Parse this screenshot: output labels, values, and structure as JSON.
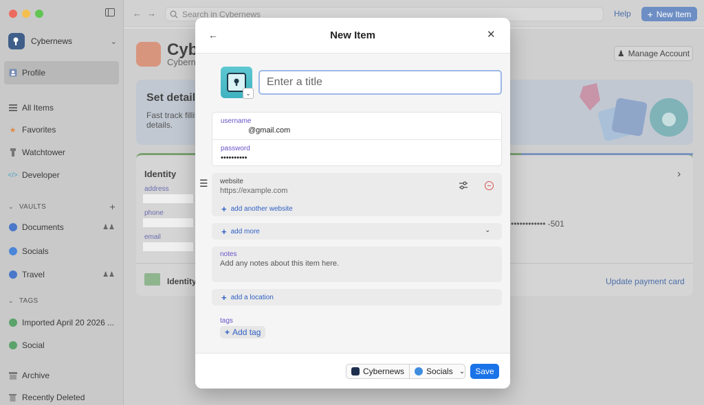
{
  "topbar": {
    "search_placeholder": "Search in Cybernews",
    "help_label": "Help",
    "new_item_label": "New Item"
  },
  "sidebar": {
    "account_name": "Cybernews",
    "profile_label": "Profile",
    "items": [
      {
        "label": "All Items",
        "icon": "all-items-icon"
      },
      {
        "label": "Favorites",
        "icon": "star-icon"
      },
      {
        "label": "Watchtower",
        "icon": "watchtower-icon"
      },
      {
        "label": "Developer",
        "icon": "code-icon"
      }
    ],
    "vaults_heading": "VAULTS",
    "vaults": [
      {
        "label": "Documents",
        "color": "#4a78c9"
      },
      {
        "label": "Socials",
        "color": "#4a86d9"
      },
      {
        "label": "Travel",
        "color": "#4a78c9"
      }
    ],
    "tags_heading": "TAGS",
    "tags": [
      {
        "label": "Imported April 20 2026 ...",
        "color": "#5aa36b"
      },
      {
        "label": "Social",
        "color": "#5aa36b"
      }
    ],
    "archive_label": "Archive",
    "deleted_label": "Recently Deleted"
  },
  "main": {
    "title": "Cyb",
    "subtitle": "Cybern",
    "manage_account_label": "Manage Account",
    "banner_title": "Set details",
    "banner_text": "Fast track fillin details.",
    "card": {
      "title": "Identity",
      "labels": [
        "address",
        "phone",
        "email"
      ],
      "masked_number": "•••••••••••• -501",
      "footer_item": "Identity",
      "update_link": "Update payment card"
    }
  },
  "modal": {
    "title": "New Item",
    "title_placeholder": "Enter a title",
    "username_label": "username",
    "username_value": "@gmail.com",
    "password_label": "password",
    "password_value": "••••••••••",
    "website_label": "website",
    "website_placeholder": "https://example.com",
    "add_website_label": "add another website",
    "add_more_label": "add more",
    "notes_label": "notes",
    "notes_placeholder": "Add any notes about this item here.",
    "add_location_label": "add a location",
    "tags_label": "tags",
    "add_tag_label": "Add tag",
    "account_picker": "Cybernews",
    "vault_picker": "Socials",
    "save_label": "Save"
  },
  "colors": {
    "accent": "#1a73e8",
    "label_purple": "#6952c7",
    "link_blue": "#2f5fc4",
    "danger": "#d9534f"
  }
}
